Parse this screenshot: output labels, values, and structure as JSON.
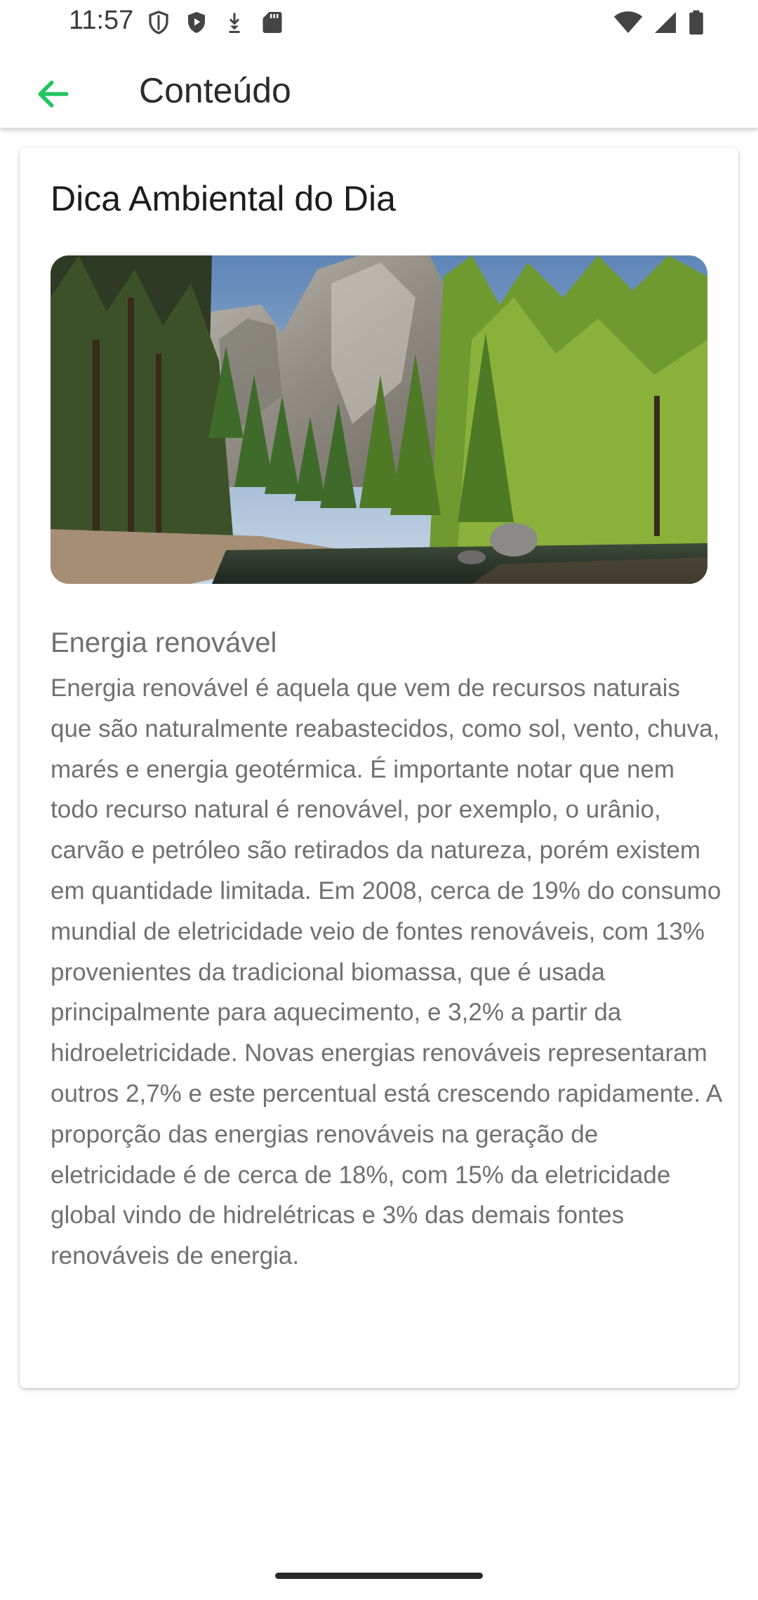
{
  "status_bar": {
    "time": "11:57",
    "left_icons": [
      "shield-outline-icon",
      "play-protect-icon",
      "download-icon",
      "sd-card-icon"
    ],
    "right_icons": [
      "wifi-icon",
      "cellular-signal-icon",
      "battery-icon"
    ]
  },
  "app_bar": {
    "back_icon": "arrow-back-icon",
    "title": "Conteúdo",
    "accent_color": "#22c55e"
  },
  "card": {
    "title": "Dica Ambiental do Dia",
    "image": {
      "subject": "forest-mountain-river-photo"
    },
    "section_title": "Energia renovável",
    "section_body": "Energia renovável é aquela que vem de recursos naturais que são naturalmente reabastecidos, como sol, vento, chuva, marés e energia geotérmica. É importante notar que nem todo recurso natural é renovável, por exemplo, o urânio, carvão e petróleo são retirados da natureza, porém existem em quantidade limitada. Em 2008, cerca de 19% do consumo mundial de eletricidade veio de fontes renováveis, com 13% provenientes da tradicional biomassa, que é usada principalmente para aquecimento, e 3,2% a partir da hidroeletricidade. Novas energias renováveis representaram outros 2,7% e este percentual está crescendo rapidamente. A proporção das energias renováveis na geração de eletricidade é de cerca de 18%, com 15% da eletricidade global vindo de hidrelétricas e 3% das demais fontes renováveis de energia."
  }
}
